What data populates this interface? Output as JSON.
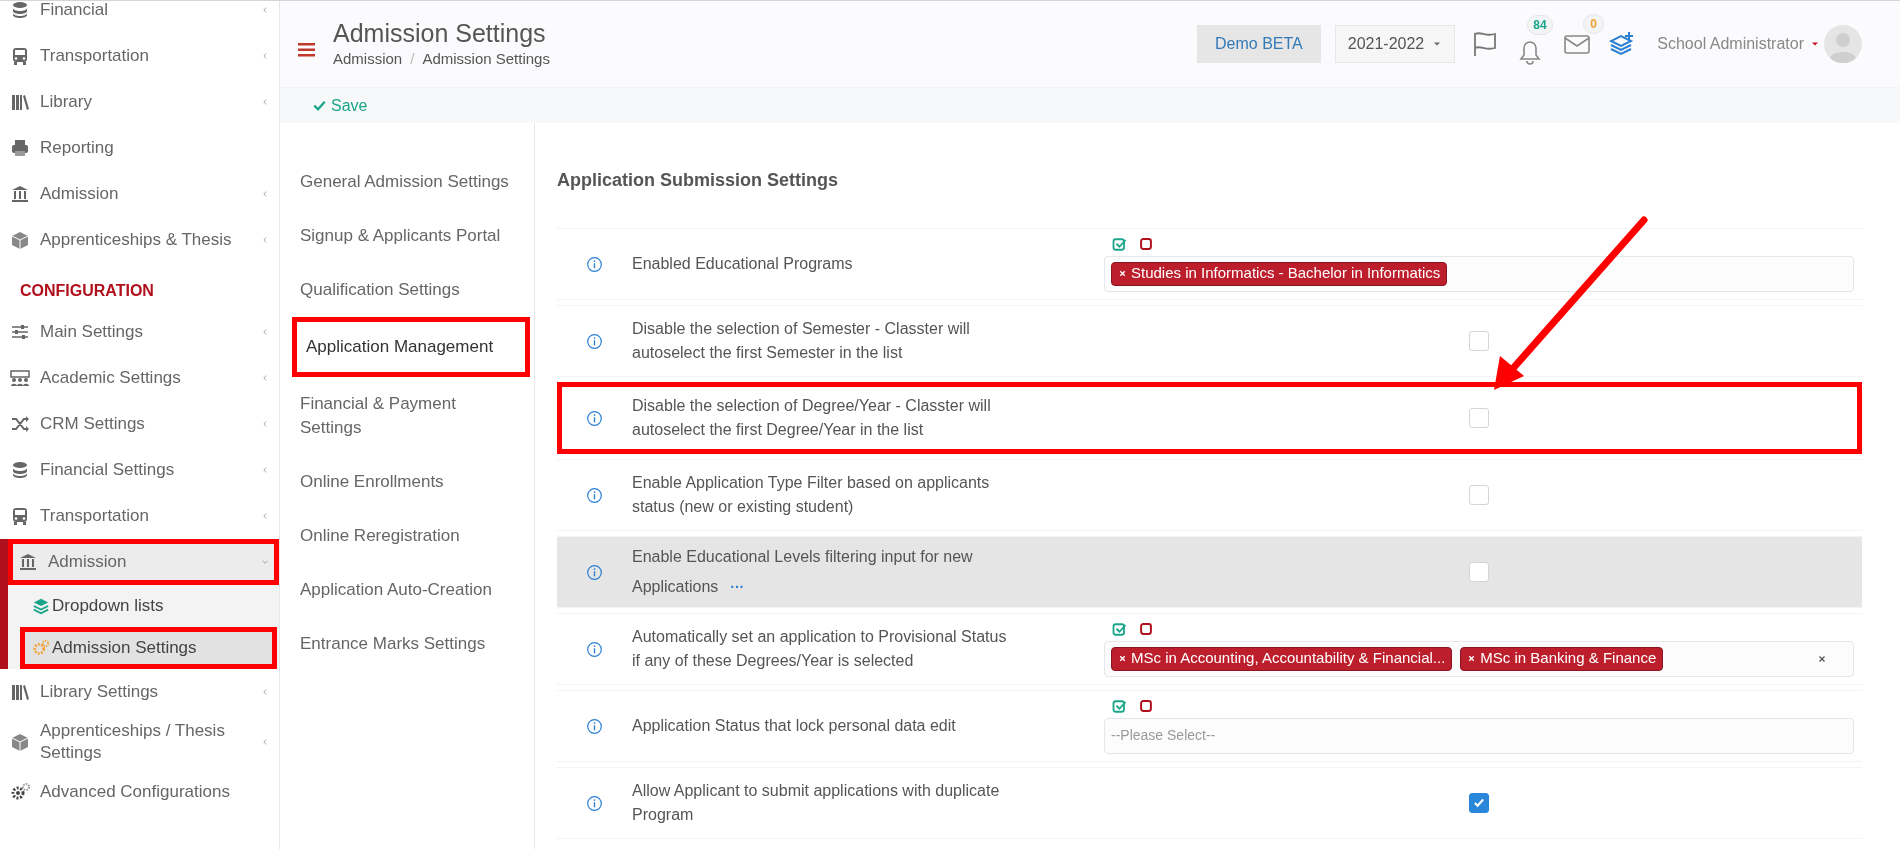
{
  "sidebar": {
    "items": [
      {
        "kind": "group",
        "label": "Financial",
        "highlighted": false
      },
      {
        "kind": "group",
        "label": "Transportation",
        "highlighted": false
      },
      {
        "kind": "group",
        "label": "Library",
        "highlighted": false
      },
      {
        "kind": "link",
        "label": "Reporting",
        "highlighted": false
      },
      {
        "kind": "group",
        "label": "Admission",
        "highlighted": false
      },
      {
        "kind": "group",
        "label": "Apprenticeships & Thesis",
        "highlighted": false
      },
      {
        "kind": "section",
        "label": "CONFIGURATION"
      },
      {
        "kind": "group",
        "label": "Main Settings",
        "highlighted": false
      },
      {
        "kind": "group",
        "label": "Academic Settings",
        "highlighted": false
      },
      {
        "kind": "group",
        "label": "CRM Settings",
        "highlighted": false
      },
      {
        "kind": "group",
        "label": "Financial Settings",
        "highlighted": false
      },
      {
        "kind": "group",
        "label": "Transportation",
        "highlighted": false
      },
      {
        "kind": "group",
        "label": "Admission",
        "highlighted": true,
        "children": [
          {
            "label": "Dropdown lists",
            "selected": false,
            "highlighted": false
          },
          {
            "label": "Admission Settings",
            "selected": true,
            "highlighted": true
          }
        ]
      },
      {
        "kind": "group",
        "label": "Library Settings",
        "highlighted": false
      },
      {
        "kind": "group",
        "label": "Apprenticeships / Thesis Settings",
        "highlighted": false
      },
      {
        "kind": "link",
        "label": "Advanced Configurations",
        "highlighted": false
      }
    ]
  },
  "header": {
    "title": "Admission Settings",
    "breadcrumb": [
      "Admission",
      "Admission Settings"
    ],
    "breadcrumb_separator": "/",
    "environment": "Demo BETA",
    "year": "2021-2022",
    "notifications": "84",
    "messages": "0",
    "user": "School Administrator"
  },
  "toolbar": {
    "save": "Save"
  },
  "settings_tabs": [
    {
      "label": "General Admission Settings",
      "selected": false,
      "highlighted": false
    },
    {
      "label": "Signup & Applicants Portal",
      "selected": false,
      "highlighted": false
    },
    {
      "label": "Qualification Settings",
      "selected": false,
      "highlighted": false
    },
    {
      "label": "Application Management",
      "selected": true,
      "highlighted": true
    },
    {
      "label": "Financial & Payment Settings",
      "selected": false,
      "highlighted": false
    },
    {
      "label": "Online Enrollments",
      "selected": false,
      "highlighted": false
    },
    {
      "label": "Online Reregistration",
      "selected": false,
      "highlighted": false
    },
    {
      "label": "Application Auto-Creation",
      "selected": false,
      "highlighted": false
    },
    {
      "label": "Entrance Marks Settings",
      "selected": false,
      "highlighted": false
    }
  ],
  "section": {
    "title": "Application Submission Settings",
    "rows": [
      {
        "kind": "multiselect",
        "label": "Enabled Educational Programs",
        "hover": false,
        "highlighted": false,
        "clearable": false,
        "tags": [
          "Studies in Informatics - Bachelor in Informatics"
        ]
      },
      {
        "kind": "checkbox",
        "label": "Disable the selection of Semester - Classter will autoselect the first Semester in the list",
        "hover": false,
        "highlighted": false,
        "checked": false
      },
      {
        "kind": "checkbox",
        "label": "Disable the selection of Degree/Year - Classter will autoselect the first Degree/Year in the list",
        "hover": false,
        "highlighted": true,
        "checked": false
      },
      {
        "kind": "checkbox",
        "label": "Enable Application Type Filter based on applicants status (new or existing student)",
        "hover": false,
        "highlighted": false,
        "checked": false
      },
      {
        "kind": "checkbox",
        "label": "Enable Educational Levels filtering input for new Applications",
        "ellipsis": "···",
        "hover": true,
        "highlighted": false,
        "checked": false
      },
      {
        "kind": "multiselect",
        "label": "Automatically set an application to Provisional Status if any of these Degrees/Year is selected",
        "hover": false,
        "highlighted": false,
        "clearable": true,
        "tags": [
          "MSc in Accounting, Accountability & Financial...",
          "MSc in Banking & Finance"
        ]
      },
      {
        "kind": "select",
        "label": "Application Status that lock personal data edit",
        "hover": false,
        "highlighted": false,
        "placeholder": "--Please Select--"
      },
      {
        "kind": "checkbox",
        "label": "Allow Applicant to submit applications with duplicate Program",
        "hover": false,
        "highlighted": false,
        "checked": true
      }
    ]
  }
}
